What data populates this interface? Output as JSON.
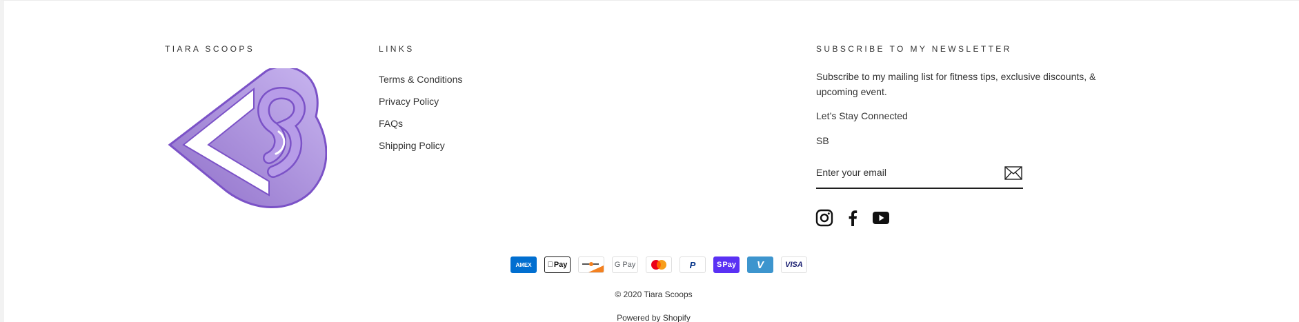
{
  "brand": {
    "heading": "TIARA SCOOPS",
    "logo_icon": "heart-s-logo",
    "logo_color": "#a78bd9"
  },
  "links": {
    "heading": "LINKS",
    "items": [
      "Terms & Conditions",
      "Privacy Policy",
      "FAQs",
      "Shipping Policy"
    ]
  },
  "newsletter": {
    "heading": "SUBSCRIBE TO MY NEWSLETTER",
    "description_line1": "Subscribe to my mailing list for fitness tips, exclusive discounts, &",
    "description_line2": "upcoming event.",
    "tagline": "Let’s Stay Connected",
    "signature": "SB",
    "email_placeholder": "Enter your email",
    "submit_icon": "envelope-icon"
  },
  "social": [
    "instagram-icon",
    "facebook-icon",
    "youtube-icon"
  ],
  "payments": {
    "amex": "AMEX",
    "apple_pay": "Pay",
    "google_pay": "G Pay",
    "paypal": "P",
    "shop_pay": "Pay",
    "venmo": "V",
    "visa": "VISA"
  },
  "footer": {
    "copyright": "© 2020 Tiara Scoops",
    "powered": "Powered by Shopify"
  },
  "colors": {
    "text": "#333333",
    "accent_purple": "#7b52c7",
    "shop_pay": "#5a31f4",
    "venmo": "#3d95ce",
    "amex": "#016fd0"
  }
}
